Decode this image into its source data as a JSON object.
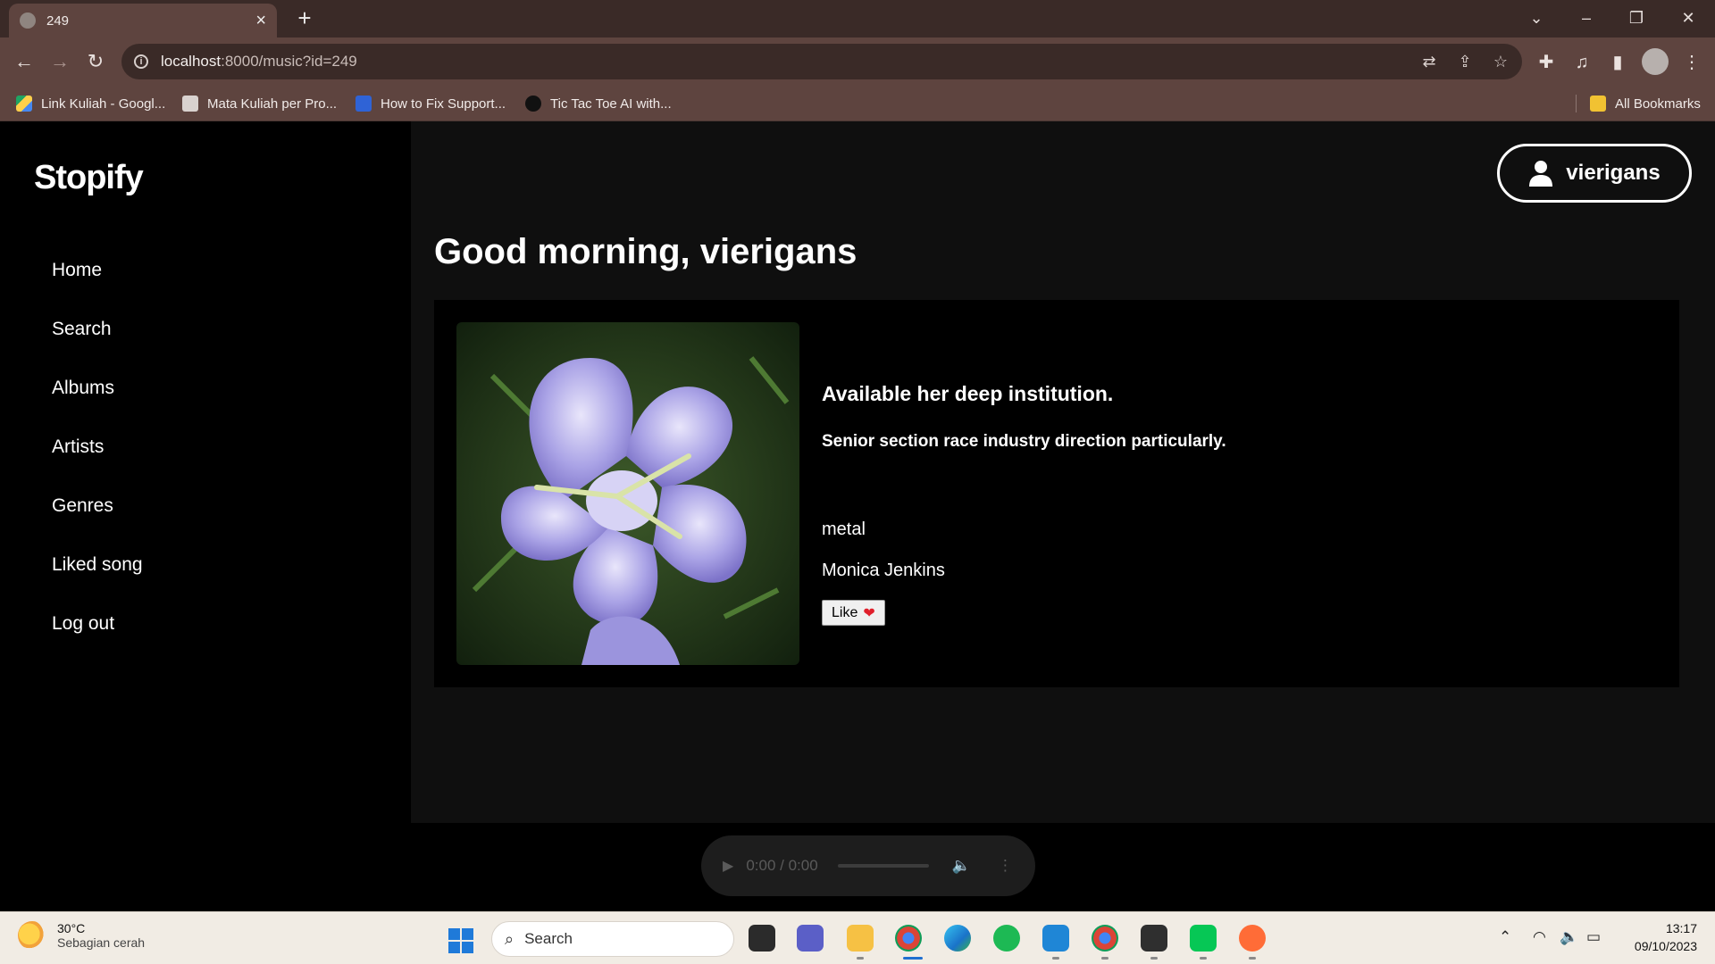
{
  "browser": {
    "tab_title": "249",
    "url_host": "localhost",
    "url_rest": ":8000/music?id=249",
    "bookmarks": [
      "Link Kuliah - Googl...",
      "Mata Kuliah per Pro...",
      "How to Fix Support...",
      "Tic Tac Toe AI with..."
    ],
    "all_bookmarks": "All Bookmarks"
  },
  "sidebar": {
    "logo": "Stopify",
    "items": [
      "Home",
      "Search",
      "Albums",
      "Artists",
      "Genres",
      "Liked song",
      "Log out"
    ]
  },
  "header": {
    "username": "vierigans",
    "greeting": "Good morning, vierigans"
  },
  "song": {
    "title": "Available her deep institution.",
    "description": "Senior section race industry direction particularly.",
    "genre": "metal",
    "artist": "Monica Jenkins",
    "like_label": "Like",
    "like_icon": "❤"
  },
  "player": {
    "time": "0:00 / 0:00"
  },
  "taskbar": {
    "temperature": "30°C",
    "condition": "Sebagian cerah",
    "search_label": "Search",
    "time": "13:17",
    "date": "09/10/2023"
  }
}
